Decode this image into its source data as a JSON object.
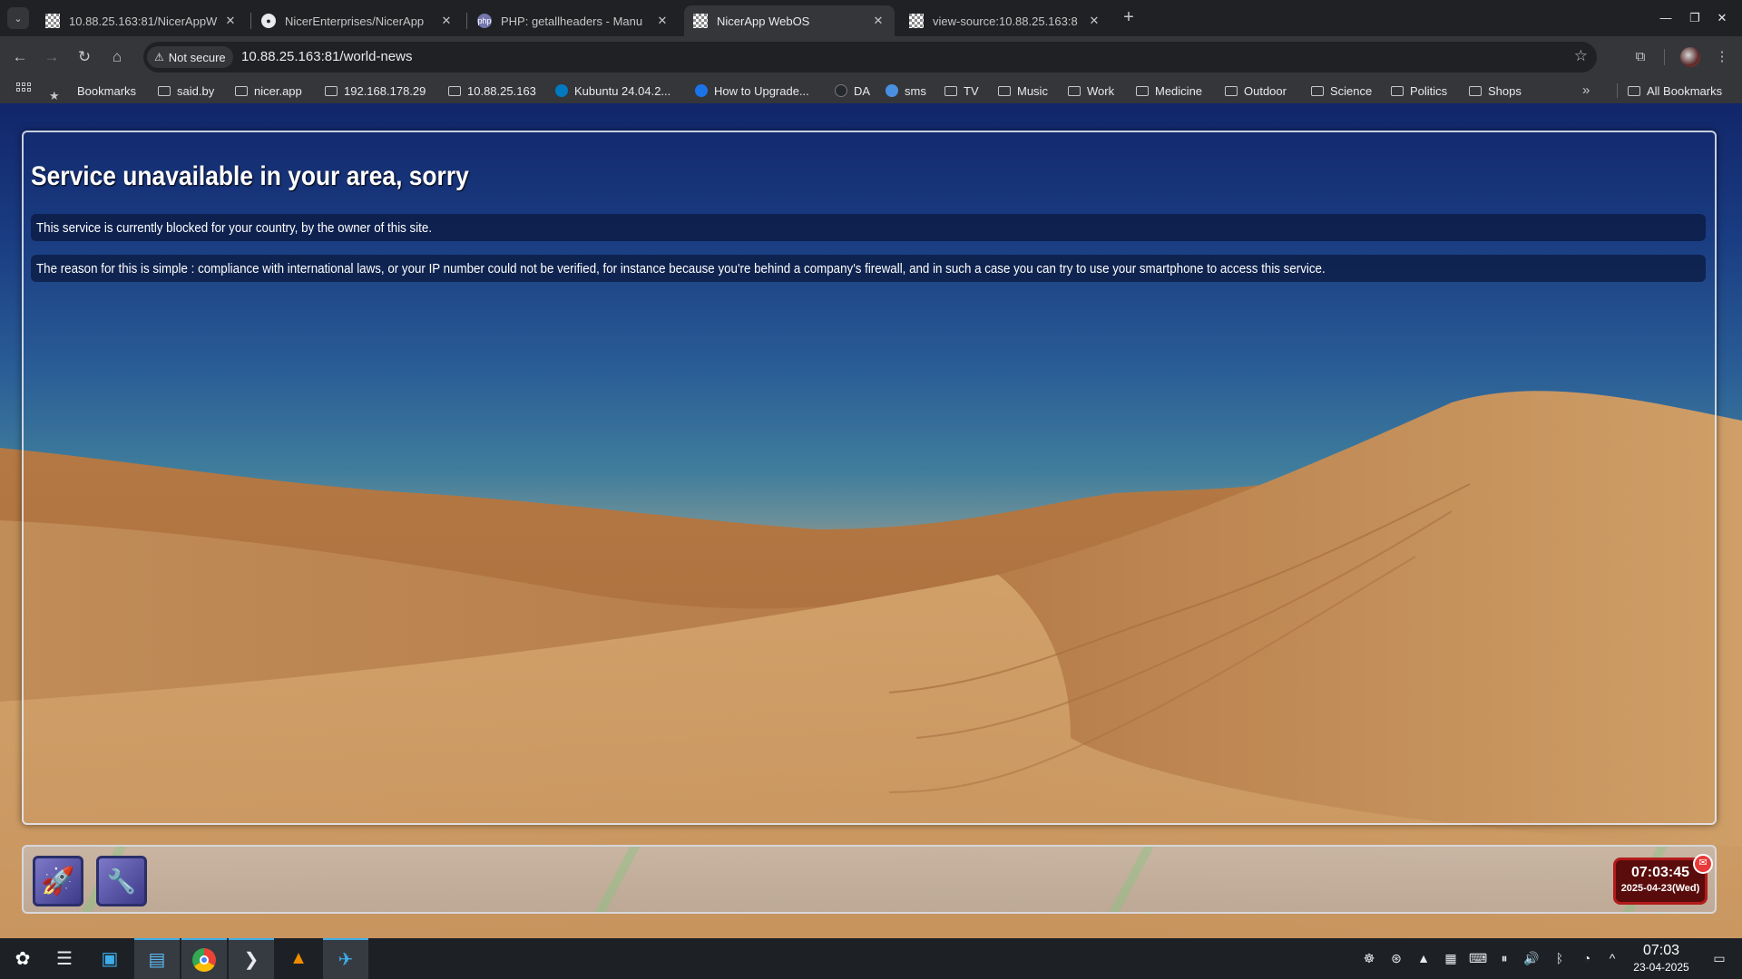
{
  "browser": {
    "tabs": [
      {
        "title": "10.88.25.163:81/NicerAppW",
        "active": false
      },
      {
        "title": "NicerEnterprises/NicerApp",
        "active": false
      },
      {
        "title": "PHP: getallheaders - Manu",
        "active": false
      },
      {
        "title": "NicerApp WebOS",
        "active": true
      },
      {
        "title": "view-source:10.88.25.163:8",
        "active": false
      }
    ],
    "security_label": "Not secure",
    "url": "10.88.25.163:81/world-news",
    "bookmarks": [
      {
        "label": "Bookmarks",
        "icon": "star-icon"
      },
      {
        "label": "said.by",
        "icon": "folder-icon"
      },
      {
        "label": "nicer.app",
        "icon": "folder-icon"
      },
      {
        "label": "192.168.178.29",
        "icon": "folder-icon"
      },
      {
        "label": "10.88.25.163",
        "icon": "folder-icon"
      },
      {
        "label": "Kubuntu 24.04.2...",
        "icon": "kubuntu-icon"
      },
      {
        "label": "How to Upgrade...",
        "icon": "info-icon"
      },
      {
        "label": "DA",
        "icon": "github-icon"
      },
      {
        "label": "sms",
        "icon": "chat-icon"
      },
      {
        "label": "TV",
        "icon": "folder-icon"
      },
      {
        "label": "Music",
        "icon": "folder-icon"
      },
      {
        "label": "Work",
        "icon": "folder-icon"
      },
      {
        "label": "Medicine",
        "icon": "folder-icon"
      },
      {
        "label": "Outdoor",
        "icon": "folder-icon"
      },
      {
        "label": "Science",
        "icon": "folder-icon"
      },
      {
        "label": "Politics",
        "icon": "folder-icon"
      },
      {
        "label": "Shops",
        "icon": "folder-icon"
      }
    ],
    "all_bookmarks_label": "All Bookmarks"
  },
  "page": {
    "title": "Service unavailable in your area, sorry",
    "message_1": "This service is currently blocked for your country, by the owner of this site.",
    "message_2": "The reason for this is simple : compliance with international laws, or your IP number could not be verified, for instance because you're behind a company's firewall, and in such a case you can try to use your smartphone to access this service."
  },
  "dock": {
    "clock_time": "07:03:45",
    "clock_date": "2025-04-23(Wed)"
  },
  "taskbar": {
    "time": "07:03",
    "date": "23-04-2025"
  }
}
